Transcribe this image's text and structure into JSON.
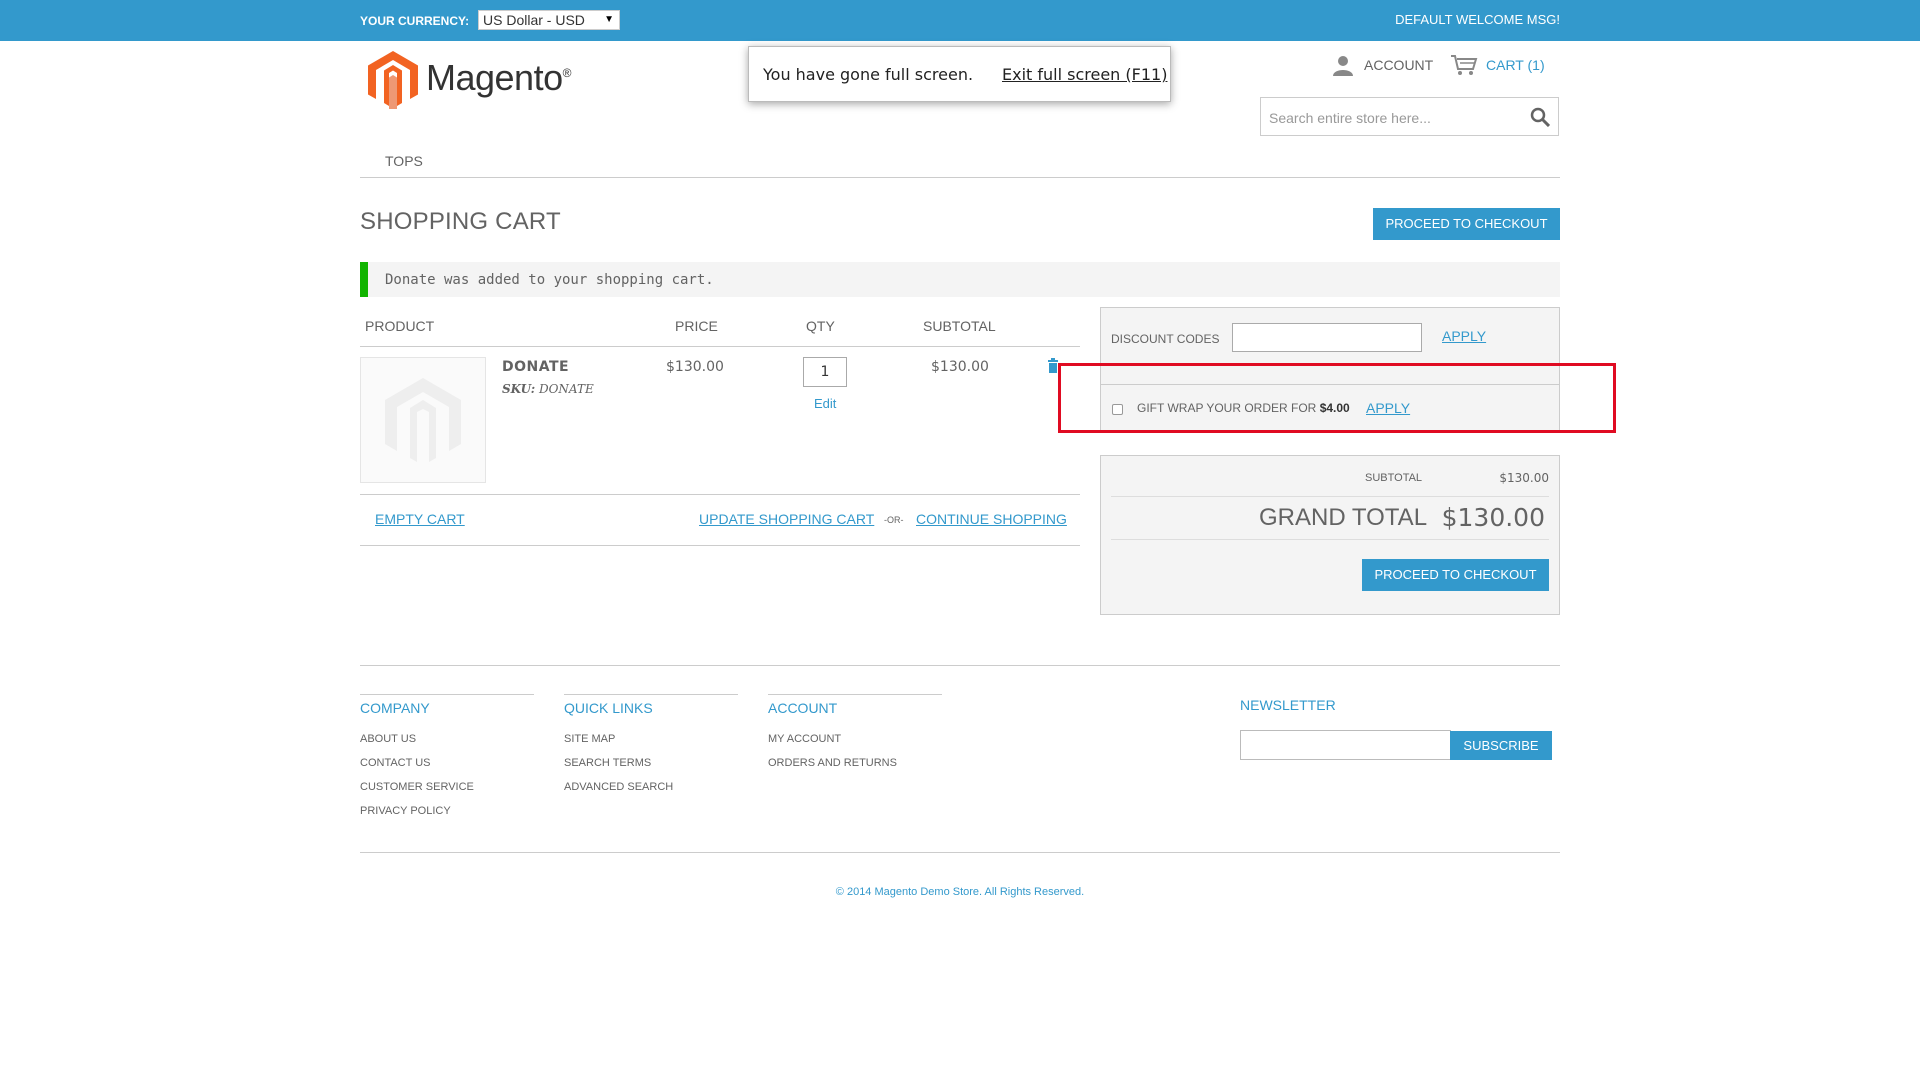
{
  "topbar": {
    "currency_label": "YOUR CURRENCY:",
    "currency_value": "US Dollar - USD",
    "welcome": "DEFAULT WELCOME MSG!"
  },
  "header": {
    "logo_text": "Magento",
    "logo_mark": "®",
    "account_label": "ACCOUNT",
    "cart_label": "CART (1)",
    "search_placeholder": "Search entire store here..."
  },
  "nav": {
    "items": [
      {
        "label": "TOPS"
      }
    ]
  },
  "fullscreen_notice": {
    "message": "You have gone full screen.",
    "exit_label": "Exit full screen (F11)"
  },
  "page": {
    "title": "SHOPPING CART",
    "checkout_label": "PROCEED TO CHECKOUT",
    "success_message": "Donate was added to your shopping cart."
  },
  "cart": {
    "columns": [
      "PRODUCT",
      "PRICE",
      "QTY",
      "SUBTOTAL"
    ],
    "items": [
      {
        "name": "DONATE",
        "sku_label": "SKU:",
        "sku": "DONATE",
        "price": "$130.00",
        "qty": "1",
        "edit_label": "Edit",
        "subtotal": "$130.00"
      }
    ],
    "empty_label": "EMPTY CART",
    "update_label": "UPDATE SHOPPING CART",
    "or_label": "-OR-",
    "continue_label": "CONTINUE SHOPPING"
  },
  "discount": {
    "label": "DISCOUNT CODES",
    "value": "",
    "apply_label": "APPLY"
  },
  "gift_wrap": {
    "label": "GIFT WRAP YOUR ORDER FOR",
    "price": "$4.00",
    "checked": false,
    "apply_label": "APPLY"
  },
  "totals": {
    "subtotal_label": "SUBTOTAL",
    "subtotal_value": "$130.00",
    "grand_label": "GRAND TOTAL",
    "grand_value": "$130.00",
    "checkout_label": "PROCEED TO CHECKOUT"
  },
  "footer": {
    "columns": [
      {
        "title": "COMPANY",
        "links": [
          "ABOUT US",
          "CONTACT US",
          "CUSTOMER SERVICE",
          "PRIVACY POLICY"
        ]
      },
      {
        "title": "QUICK LINKS",
        "links": [
          "SITE MAP",
          "SEARCH TERMS",
          "ADVANCED SEARCH"
        ]
      },
      {
        "title": "ACCOUNT",
        "links": [
          "MY ACCOUNT",
          "ORDERS AND RETURNS"
        ]
      }
    ],
    "newsletter_title": "NEWSLETTER",
    "subscribe_label": "SUBSCRIBE",
    "copyright": "© 2014 Magento Demo Store. All Rights Reserved."
  },
  "colors": {
    "brand_blue": "#3399cc",
    "success_green": "#11b400",
    "highlight_red": "#e00b22",
    "logo_orange": "#f26322"
  }
}
